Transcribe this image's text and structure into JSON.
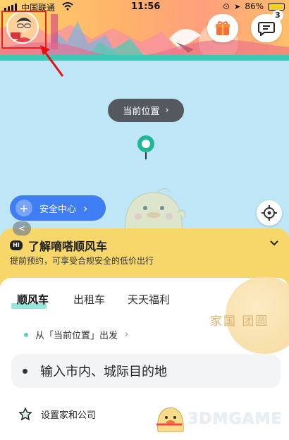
{
  "status_bar": {
    "carrier": "中国联通",
    "time": "11:56",
    "battery": "86%"
  },
  "header": {
    "avatar_icon": "user-avatar",
    "gift_icon": "gift-icon",
    "message_icon": "message-icon",
    "message_badge": "3"
  },
  "map": {
    "current_location_label": "当前位置",
    "safety_center_label": "安全中心",
    "collapse_label": "<"
  },
  "info_banner": {
    "badge": "HI",
    "title": "了解嘀嗒顺风车",
    "subtitle": "提前预约，可享受合规安全的低价出行"
  },
  "tabs": [
    {
      "label": "顺风车",
      "active": true
    },
    {
      "label": "出租车",
      "active": false
    },
    {
      "label": "天天福利",
      "active": false
    }
  ],
  "festival_text": "家国 团圆",
  "from_row": {
    "text": "从「当前位置」出发"
  },
  "destination": {
    "placeholder": "输入市内、城际目的地"
  },
  "home_row": {
    "label": "设置家和公司"
  },
  "watermark": "3DMGAME",
  "colors": {
    "accent_teal": "#55d3c3",
    "safety_blue": "#3f7df4",
    "banner_yellow": "#f7d769",
    "annotation_red": "#e21111"
  }
}
